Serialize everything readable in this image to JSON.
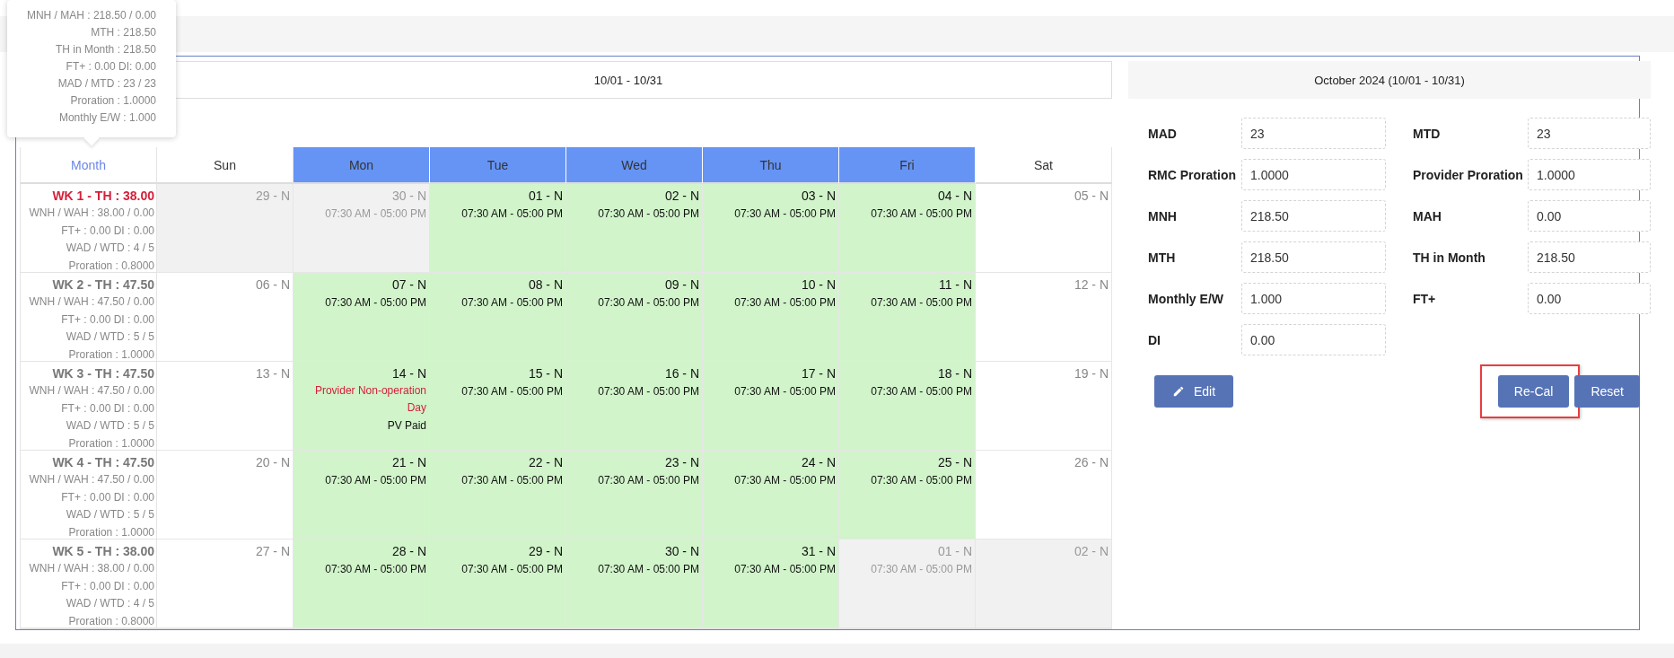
{
  "tooltip": {
    "lines": [
      "MNH / MAH : 218.50 / 0.00",
      "MTH : 218.50",
      "TH in Month : 218.50",
      "FT+ : 0.00 DI: 0.00",
      "MAD / MTD : 23 / 23",
      "Proration : 1.0000",
      "Monthly E/W : 1.000"
    ]
  },
  "calendar": {
    "title": "10/01 - 10/31",
    "month_header": "Month",
    "day_headers": [
      {
        "label": "Sun",
        "highlighted": false
      },
      {
        "label": "Mon",
        "highlighted": true
      },
      {
        "label": "Tue",
        "highlighted": true
      },
      {
        "label": "Wed",
        "highlighted": true
      },
      {
        "label": "Thu",
        "highlighted": true
      },
      {
        "label": "Fri",
        "highlighted": true
      },
      {
        "label": "Sat",
        "highlighted": false
      }
    ],
    "weeks": [
      {
        "title": "WK 1 - TH : 38.00",
        "alert": true,
        "lines": [
          "WNH / WAH : 38.00 / 0.00",
          "FT+ : 0.00 DI : 0.00",
          "WAD / WTD : 4 / 5",
          "Proration : 0.8000"
        ],
        "days": [
          {
            "date": "29 - N",
            "kind": "outside"
          },
          {
            "date": "30 - N",
            "kind": "outside",
            "hours": "07:30 AM - 05:00 PM"
          },
          {
            "date": "01 - N",
            "kind": "work",
            "hours": "07:30 AM - 05:00 PM"
          },
          {
            "date": "02 - N",
            "kind": "work",
            "hours": "07:30 AM - 05:00 PM"
          },
          {
            "date": "03 - N",
            "kind": "work",
            "hours": "07:30 AM - 05:00 PM"
          },
          {
            "date": "04 - N",
            "kind": "work",
            "hours": "07:30 AM - 05:00 PM"
          },
          {
            "date": "05 - N",
            "kind": "off"
          }
        ]
      },
      {
        "title": "WK 2 - TH : 47.50",
        "alert": false,
        "lines": [
          "WNH / WAH : 47.50 / 0.00",
          "FT+ : 0.00 DI : 0.00",
          "WAD / WTD : 5 / 5",
          "Proration : 1.0000"
        ],
        "days": [
          {
            "date": "06 - N",
            "kind": "off"
          },
          {
            "date": "07 - N",
            "kind": "work",
            "hours": "07:30 AM - 05:00 PM"
          },
          {
            "date": "08 - N",
            "kind": "work",
            "hours": "07:30 AM - 05:00 PM"
          },
          {
            "date": "09 - N",
            "kind": "work",
            "hours": "07:30 AM - 05:00 PM"
          },
          {
            "date": "10 - N",
            "kind": "work",
            "hours": "07:30 AM - 05:00 PM"
          },
          {
            "date": "11 - N",
            "kind": "work",
            "hours": "07:30 AM - 05:00 PM"
          },
          {
            "date": "12 - N",
            "kind": "off"
          }
        ]
      },
      {
        "title": "WK 3 - TH : 47.50",
        "alert": false,
        "lines": [
          "WNH / WAH : 47.50 / 0.00",
          "FT+ : 0.00 DI : 0.00",
          "WAD / WTD : 5 / 5",
          "Proration : 1.0000"
        ],
        "days": [
          {
            "date": "13 - N",
            "kind": "off"
          },
          {
            "date": "14 - N",
            "kind": "work",
            "note": "Provider Non-operation Day",
            "paid": "PV Paid"
          },
          {
            "date": "15 - N",
            "kind": "work",
            "hours": "07:30 AM - 05:00 PM"
          },
          {
            "date": "16 - N",
            "kind": "work",
            "hours": "07:30 AM - 05:00 PM"
          },
          {
            "date": "17 - N",
            "kind": "work",
            "hours": "07:30 AM - 05:00 PM"
          },
          {
            "date": "18 - N",
            "kind": "work",
            "hours": "07:30 AM - 05:00 PM"
          },
          {
            "date": "19 - N",
            "kind": "off"
          }
        ]
      },
      {
        "title": "WK 4 - TH : 47.50",
        "alert": false,
        "lines": [
          "WNH / WAH : 47.50 / 0.00",
          "FT+ : 0.00 DI : 0.00",
          "WAD / WTD : 5 / 5",
          "Proration : 1.0000"
        ],
        "days": [
          {
            "date": "20 - N",
            "kind": "off"
          },
          {
            "date": "21 - N",
            "kind": "work",
            "hours": "07:30 AM - 05:00 PM"
          },
          {
            "date": "22 - N",
            "kind": "work",
            "hours": "07:30 AM - 05:00 PM"
          },
          {
            "date": "23 - N",
            "kind": "work",
            "hours": "07:30 AM - 05:00 PM"
          },
          {
            "date": "24 - N",
            "kind": "work",
            "hours": "07:30 AM - 05:00 PM"
          },
          {
            "date": "25 - N",
            "kind": "work",
            "hours": "07:30 AM - 05:00 PM"
          },
          {
            "date": "26 - N",
            "kind": "off"
          }
        ]
      },
      {
        "title": "WK 5 - TH : 38.00",
        "alert": false,
        "lines": [
          "WNH / WAH : 38.00 / 0.00",
          "FT+ : 0.00 DI : 0.00",
          "WAD / WTD : 4 / 5",
          "Proration : 0.8000"
        ],
        "days": [
          {
            "date": "27 - N",
            "kind": "off"
          },
          {
            "date": "28 - N",
            "kind": "work",
            "hours": "07:30 AM - 05:00 PM"
          },
          {
            "date": "29 - N",
            "kind": "work",
            "hours": "07:30 AM - 05:00 PM"
          },
          {
            "date": "30 - N",
            "kind": "work",
            "hours": "07:30 AM - 05:00 PM"
          },
          {
            "date": "31 - N",
            "kind": "work",
            "hours": "07:30 AM - 05:00 PM"
          },
          {
            "date": "01 - N",
            "kind": "outside",
            "hours": "07:30 AM - 05:00 PM"
          },
          {
            "date": "02 - N",
            "kind": "outside"
          }
        ]
      }
    ]
  },
  "summary": {
    "title": "October 2024 (10/01 - 10/31)",
    "fields": [
      {
        "label": "MAD",
        "value": "23"
      },
      {
        "label": "MTD",
        "value": "23"
      },
      {
        "label": "RMC Proration",
        "value": "1.0000"
      },
      {
        "label": "Provider Proration",
        "value": "1.0000"
      },
      {
        "label": "MNH",
        "value": "218.50"
      },
      {
        "label": "MAH",
        "value": "0.00"
      },
      {
        "label": "MTH",
        "value": "218.50"
      },
      {
        "label": "TH in Month",
        "value": "218.50"
      },
      {
        "label": "Monthly E/W",
        "value": "1.000"
      },
      {
        "label": "FT+",
        "value": "0.00"
      },
      {
        "label": "DI",
        "value": "0.00"
      }
    ],
    "buttons": [
      {
        "label": "Edit",
        "kind": "edit",
        "highlighted": false
      },
      {
        "label": "Re-Cal",
        "kind": "plain",
        "highlighted": true
      },
      {
        "label": "Reset",
        "kind": "plain",
        "highlighted": false
      }
    ]
  }
}
